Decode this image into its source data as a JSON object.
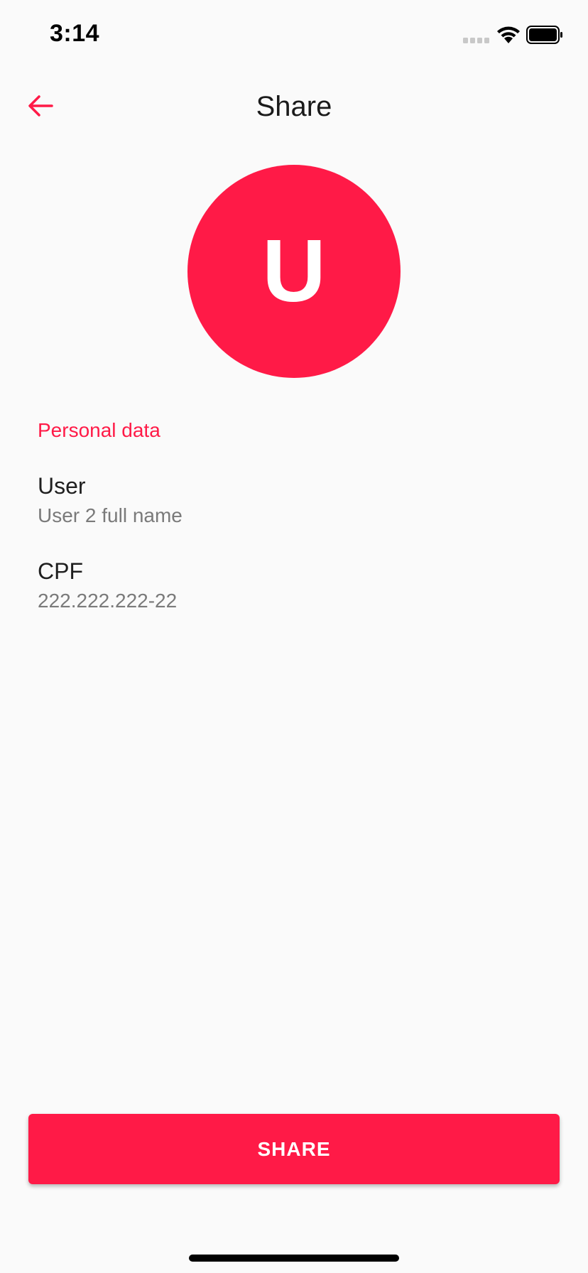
{
  "status_bar": {
    "time": "3:14",
    "icons": [
      "signal-icon",
      "wifi-icon",
      "battery-icon"
    ]
  },
  "app_bar": {
    "title": "Share",
    "back_icon": "arrow-left-icon"
  },
  "avatar": {
    "letter": "U"
  },
  "personal_data": {
    "section_title": "Personal data",
    "fields": [
      {
        "label": "User",
        "value": "User 2 full name"
      },
      {
        "label": "CPF",
        "value": "222.222.222-22"
      }
    ]
  },
  "actions": {
    "share_label": "SHARE"
  },
  "colors": {
    "accent": "#ff1a47",
    "background": "#fafafa",
    "secondary_text": "#7a7a7a"
  }
}
